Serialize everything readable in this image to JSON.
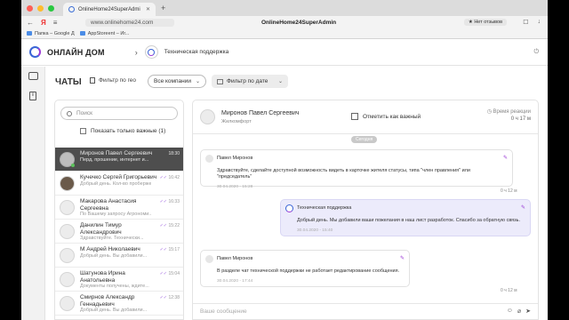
{
  "browser": {
    "tab_title": "OnlineHome24SuperAdmi",
    "url": "www.onlinehome24.com",
    "page_title": "OnlineHome24SuperAdmin",
    "feedback": "★ Нет отзывов",
    "yandex_label": "Я",
    "bookmarks": [
      "Папка – Google Д",
      "AppStoreent – Иг..."
    ]
  },
  "header": {
    "brand": "ОНЛАЙН ДОМ",
    "breadcrumb": "Техническая поддержка"
  },
  "toolbar": {
    "title": "ЧАТЫ",
    "geo_filter": "Фильтр по гео",
    "company_select": "Все компании",
    "date_filter": "Фильтр по дате"
  },
  "chats_panel": {
    "search_placeholder": "Поиск",
    "important_only": "Показать только важные (1)",
    "items": [
      {
        "name": "Миронов Павел Сергеевич",
        "preview": "Перд, прошение, интернет и...",
        "time": "18:30",
        "active": true
      },
      {
        "name": "Кучечко Сергей Григорьевич",
        "preview": "Добрый день. Кол-во проберже...",
        "time": "16:42"
      },
      {
        "name": "Макарова Анастасия Сергеевна",
        "preview": "По Вашему запросу Агрономи...",
        "time": "16:33"
      },
      {
        "name": "Данилин Тимур Александрович",
        "preview": "Здравствуйте. Технически...",
        "time": "15:22"
      },
      {
        "name": "М Андрей Николаевич",
        "preview": "Добрый день. Вы добавили...",
        "time": "15:17"
      },
      {
        "name": "Шатунова Ирина Анатольевна",
        "preview": "Документы получены, ждите...",
        "time": "15:04"
      },
      {
        "name": "Смирнов Александр Геннадьевич",
        "preview": "Добрый день. Вы добавили...",
        "time": "12:38"
      }
    ]
  },
  "conversation": {
    "name": "Миронов Павел Сергеевич",
    "role": "Жилкомфорт",
    "mark_important": "Отметить как важный",
    "reaction_label": "Время реакции",
    "reaction_value": "0 ч 17 м",
    "day_label": "Сегодня",
    "messages": [
      {
        "author": "Павел Миронов",
        "text": "Здравствуйте, сделайте доступной возможность видеть в карточке жителя статусы, типа \"член правления\" или \"председатель\"",
        "date": "30.04.2020 - 15:28",
        "timer": "0 ч 12 м"
      },
      {
        "author": "Техническая поддержка",
        "text": "Добрый день. Мы добавили ваши пожелания в наш лист разработок. Спасибо за обратную связь.",
        "date": "30.04.2020 - 15:40"
      },
      {
        "author": "Павел Миронов",
        "text": "В разделе чат технической поддержки не работает редактирование сообщения.",
        "date": "30.04.2020 - 17:44",
        "timer": "0 ч 12 м"
      }
    ],
    "composer_placeholder": "Ваше сообщение"
  }
}
